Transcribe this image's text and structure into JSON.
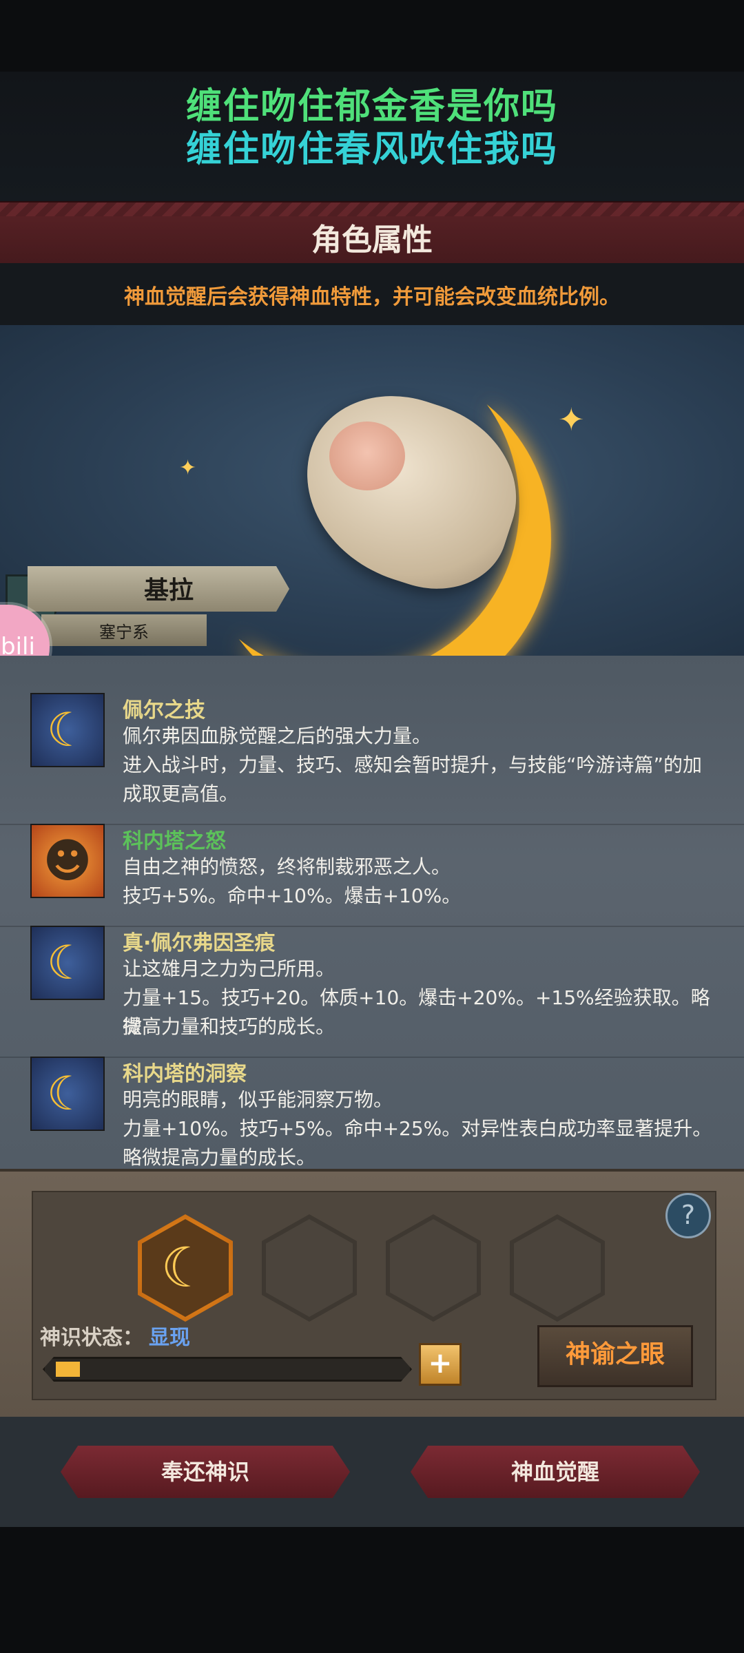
{
  "lyrics": {
    "line1": "缠住吻住郁金香是你吗",
    "line2": "缠住吻住春风吹住我吗"
  },
  "header": {
    "title": "角色属性",
    "subtitle": "神血觉醒后会获得神血特性，并可能会改变血统比例。"
  },
  "character": {
    "name": "基拉",
    "faction": "塞宁系"
  },
  "overlay": {
    "bili_label": "bili"
  },
  "traits": [
    {
      "name": "佩尔之技",
      "name_color": "#e8d88a",
      "icon": "crescent-moon-icon",
      "desc": [
        "佩尔弗因血脉觉醒之后的强大力量。",
        "进入战斗时，力量、技巧、感知会暂时提升，与技能“吟游诗篇”的加",
        "成取更高值。"
      ]
    },
    {
      "name": "科内塔之怒",
      "name_color": "#5cc25a",
      "icon": "angry-sun-face-icon",
      "desc": [
        "自由之神的愤怒，终将制裁邪恶之人。",
        "技巧+5%。命中+10%。爆击+10%。"
      ]
    },
    {
      "name": "真·佩尔弗因圣痕",
      "name_color": "#e8d88a",
      "icon": "crescent-moon-icon",
      "desc": [
        "让这雄月之力为己所用。",
        "力量+15。技巧+20。体质+10。爆击+20%。+15%经验获取。略微",
        "提高力量和技巧的成长。"
      ]
    },
    {
      "name": "科内塔的洞察",
      "name_color": "#e8d88a",
      "icon": "crescent-moon-icon",
      "desc": [
        "明亮的眼睛，似乎能洞察万物。",
        "力量+10%。技巧+5%。命中+25%。对异性表白成功率显著提升。",
        "略微提高力量的成长。"
      ]
    }
  ],
  "panel": {
    "state_label": "神识状态：",
    "state_value": "显现",
    "progress": 0.07,
    "oracle_button": "神谕之眼",
    "help_icon": "?",
    "plus_icon": "+"
  },
  "buttons": {
    "return_label": "奉还神识",
    "awaken_label": "神血觉醒"
  },
  "colors": {
    "accent": "#f09a3a",
    "title_band": "#5a2226",
    "lyric1": "#4fe07a",
    "lyric2": "#35d2d6"
  }
}
